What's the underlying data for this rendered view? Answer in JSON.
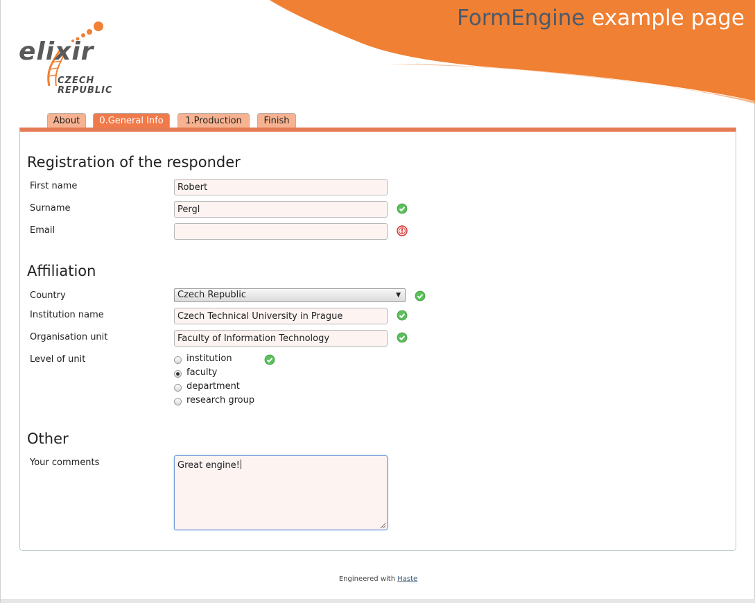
{
  "header": {
    "title_part1": "FormEngine",
    "title_part2": " example page"
  },
  "logo": {
    "word": "elixir",
    "subtitle_line1": "CZECH",
    "subtitle_line2": "REPUBLIC"
  },
  "tabs": [
    {
      "label": "About",
      "active": false
    },
    {
      "label": "0.General Info",
      "active": true
    },
    {
      "label": "1.Production",
      "active": false
    },
    {
      "label": "Finish",
      "active": false
    }
  ],
  "sections": {
    "registration": "Registration of the responder",
    "affiliation": "Affiliation",
    "other": "Other"
  },
  "fields": {
    "first_name": {
      "label": "First name",
      "value": "Robert"
    },
    "surname": {
      "label": "Surname",
      "value": "Pergl",
      "status": "ok"
    },
    "email": {
      "label": "Email",
      "value": "",
      "status": "error"
    },
    "country": {
      "label": "Country",
      "value": "Czech Republic",
      "status": "ok"
    },
    "institution": {
      "label": "Institution name",
      "value": "Czech Technical University in Prague",
      "status": "ok"
    },
    "org_unit": {
      "label": "Organisation unit",
      "value": "Faculty of Information Technology",
      "status": "ok"
    },
    "level": {
      "label": "Level of unit",
      "status": "ok",
      "options": [
        "institution",
        "faculty",
        "department",
        "research group"
      ],
      "selected": "faculty"
    },
    "comments": {
      "label": "Your comments",
      "value": "Great engine!"
    }
  },
  "footer": {
    "prefix": "Engineered with ",
    "link": "Haste"
  },
  "colors": {
    "accent_orange": "#f08033",
    "tab_inactive": "#f7b391",
    "tab_active": "#f07a4a",
    "ok_green": "#4caf50",
    "error_red": "#e53935"
  }
}
